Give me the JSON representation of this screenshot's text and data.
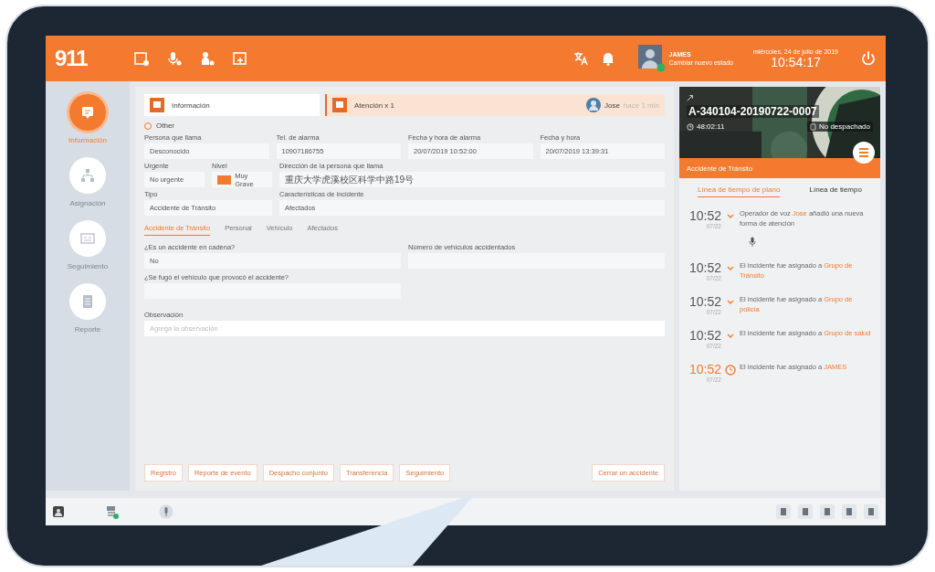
{
  "header": {
    "logo": "911",
    "user_name": "JAMES",
    "user_status": "Cambiar nuevo estado",
    "date": "miércoles, 24 de julio de 2019",
    "time": "10:54:17"
  },
  "nav": [
    {
      "label": "Información",
      "selected": true
    },
    {
      "label": "Asignación",
      "selected": false
    },
    {
      "label": "Seguimiento",
      "selected": false
    },
    {
      "label": "Reporte",
      "selected": false
    }
  ],
  "tabs": [
    {
      "label": "Información",
      "selected": false
    },
    {
      "label": "Atención x 1",
      "selected": true
    }
  ],
  "agent": {
    "name": "Jose",
    "note": "hace 1 min"
  },
  "radio": {
    "label": "Other",
    "selected": false
  },
  "fields": [
    {
      "label": "Persona que llama",
      "value": "Desconocido"
    },
    {
      "label": "Tel. de alarma",
      "value": "10907186755"
    },
    {
      "label": "Fecha y hora de alarma",
      "value": "20/07/2019 10:52:00"
    },
    {
      "label": "Fecha y hora",
      "value": "20/07/2019 13:39:31"
    }
  ],
  "urgency": {
    "label": "Urgente",
    "value": "No urgente"
  },
  "level": {
    "label": "Nivel",
    "value": "Muy Grave",
    "color": "#f47a2f"
  },
  "address": {
    "label": "Dirección de la persona que llama",
    "value": "重庆大学虎溪校区科学中路19号"
  },
  "type": {
    "label": "Tipo",
    "value": "Accidente de Tránsito"
  },
  "features": {
    "label": "Características de incidente",
    "value": "Afectados"
  },
  "subtabs": [
    {
      "label": "Accidente de Tránsito",
      "selected": true
    },
    {
      "label": "Personal",
      "selected": false
    },
    {
      "label": "Vehículo",
      "selected": false
    },
    {
      "label": "Afectados",
      "selected": false
    }
  ],
  "questions": [
    {
      "label": "¿Es un accidente en cadena?",
      "value": "No"
    },
    {
      "label": "Número de vehículos accidentados"
    },
    {
      "label": "¿Se fugó el vehículo que provocó el accidente?"
    }
  ],
  "observation": {
    "label": "Observación",
    "placeholder": "Agrega la observación"
  },
  "actions": [
    "Registro",
    "Reporte de evento",
    "Despacho conjunto",
    "Transferencia",
    "Seguimiento"
  ],
  "close_action": "Cerrar un accidente",
  "incident": {
    "code": "A-340104-20190722-0007",
    "elapsed": "48:02:11",
    "status": "No despachado",
    "type": "Accidente de Tránsito"
  },
  "timeline_tabs": [
    {
      "label": "Línea de tiempo de plano",
      "selected": true
    },
    {
      "label": "Línea de tiempo",
      "selected": false
    }
  ],
  "timeline": [
    {
      "time": "10:52",
      "date": "07/22",
      "before": "Operador de voz ",
      "highlight": "Jose",
      "after": " añadió una nueva forma de atención",
      "current": false,
      "audio": true
    },
    {
      "time": "10:52",
      "date": "07/22",
      "before": "El incidente fue asignado a ",
      "highlight": "Grupo de Tránsito",
      "current": false,
      "audio": false
    },
    {
      "time": "10:52",
      "date": "07/22",
      "before": "El incidente fue asignado a ",
      "highlight": "Grupo de policía",
      "current": false,
      "audio": false
    },
    {
      "time": "10:52",
      "date": "07/22",
      "before": "El incidente fue asignado a ",
      "highlight": "Grupo de salud",
      "current": false,
      "audio": false
    },
    {
      "time": "10:52",
      "date": "07/22",
      "before": "El incidente fue asignado a ",
      "highlight": "JAMES",
      "current": true,
      "audio": false
    }
  ]
}
